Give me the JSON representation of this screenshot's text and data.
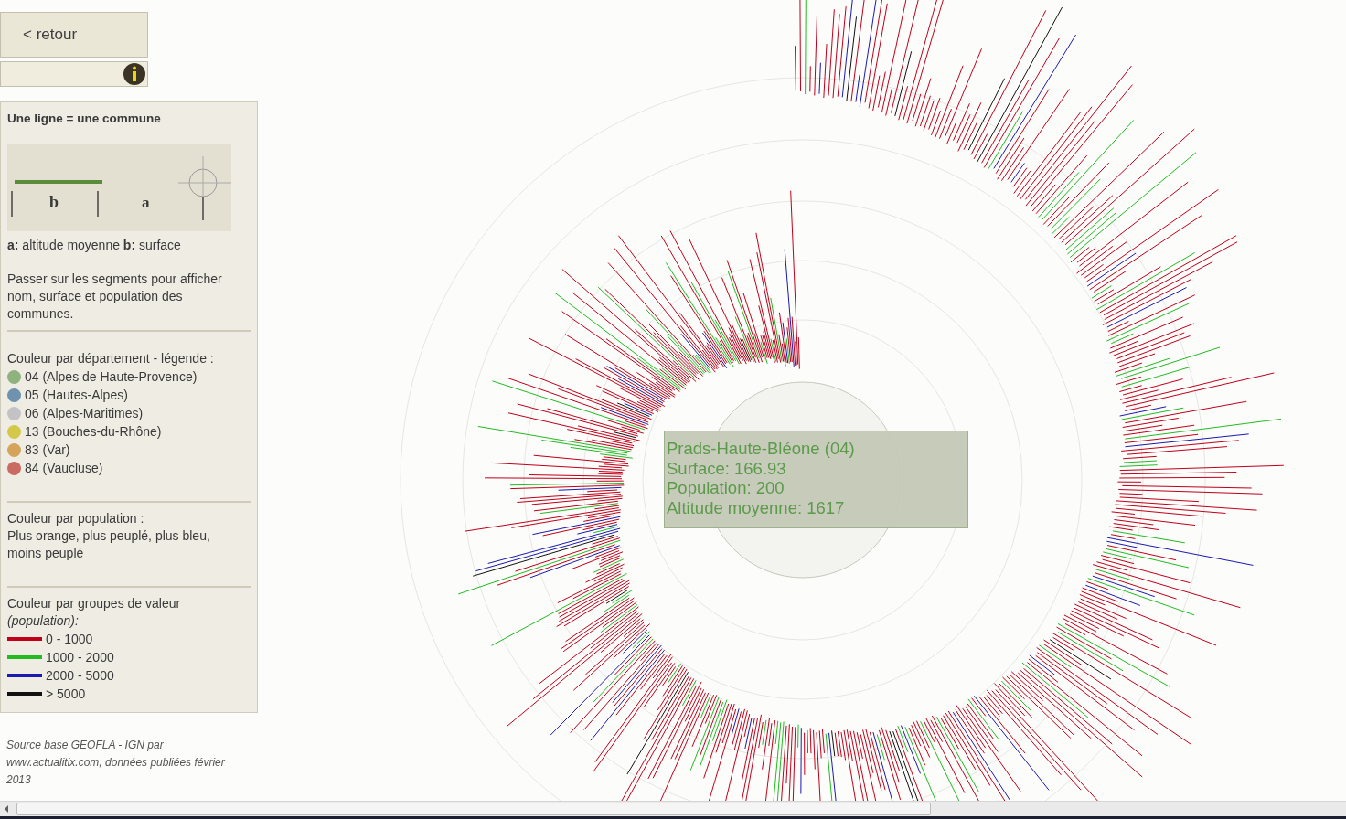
{
  "back_button": {
    "label": "< retour"
  },
  "legend": {
    "title": "Une ligne = une commune",
    "diagram_labels": [
      "b",
      "a"
    ],
    "axis_note": "**a:** altitude moyenne **b:** surface",
    "hint": "Passer sur les segments pour afficher nom, surface et population des communes.",
    "department_title": "Couleur par département - légende :",
    "departments": [
      {
        "label": "04 (Alpes de Haute-Provence)",
        "color": "#8fb37e"
      },
      {
        "label": "05 (Hautes-Alpes)",
        "color": "#6f93ae"
      },
      {
        "label": "06 (Alpes-Maritimes)",
        "color": "#c3c3c6"
      },
      {
        "label": "13 (Bouches-du-Rhône)",
        "color": "#d4c84a"
      },
      {
        "label": "83 (Var)",
        "color": "#d4a45a"
      },
      {
        "label": "84 (Vaucluse)",
        "color": "#c96a63"
      }
    ],
    "population_title": "Couleur par population :",
    "population_text": "Plus orange, plus peuplé, plus bleu, moins peuplé",
    "groups_title": "Couleur par groupes de valeur",
    "groups_subtitle": "(population):",
    "groups": [
      {
        "label": "0 - 1000",
        "color": "#c0001a"
      },
      {
        "label": "1000 - 2000",
        "color": "#22bb22"
      },
      {
        "label": "2000 - 5000",
        "color": "#1a1ab0"
      },
      {
        "label": "> 5000",
        "color": "#111111"
      }
    ]
  },
  "source": "Source base GEOFLA - IGN par www.actualitix.com, données publiées février 2013",
  "tooltip": {
    "lines": [
      "Prads-Haute-Bléone (04)",
      "Surface: 166.93",
      "Population: 200",
      "Altitude moyenne: 1617"
    ]
  }
}
